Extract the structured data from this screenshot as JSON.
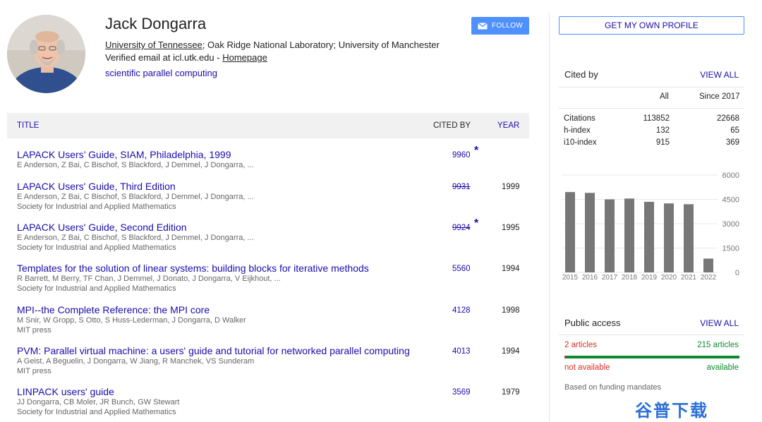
{
  "profile": {
    "name": "Jack Dongarra",
    "affiliation_link": "University of Tennessee",
    "affiliation_rest": "; Oak Ridge National Laboratory; University of Manchester",
    "email_text": "Verified email at icl.utk.edu - ",
    "homepage_label": "Homepage",
    "interest": "scientific parallel computing",
    "follow_label": "FOLLOW",
    "follow_icon": "envelope-icon"
  },
  "table": {
    "col_title": "TITLE",
    "col_cited": "CITED BY",
    "col_year": "YEAR",
    "rows": [
      {
        "title": "LAPACK Users’ Guide, SIAM, Philadelphia, 1999",
        "authors": "E Anderson, Z Bai, C Bischof, S Blackford, J Demmel, J Dongarra, ...",
        "venue": "",
        "cited": "9960",
        "strike": false,
        "star": "*",
        "year": ""
      },
      {
        "title": "LAPACK Users' Guide, Third Edition",
        "authors": "E Anderson, Z Bai, C Bischof, S Blackford, J Demmel, J Dongarra, ...",
        "venue": "Society for Industrial and Applied Mathematics",
        "cited": "9931",
        "strike": true,
        "star": "",
        "year": "1999"
      },
      {
        "title": "LAPACK Users' Guide, Second Edition",
        "authors": "E Anderson, Z Bai, C Bischof, S Blackford, J Demmel, J Dongarra, ...",
        "venue": "Society for Industrial and Applied Mathematics",
        "cited": "9924",
        "strike": true,
        "star": "*",
        "year": "1995"
      },
      {
        "title": "Templates for the solution of linear systems: building blocks for iterative methods",
        "authors": "R Barrett, M Berry, TF Chan, J Demmel, J Donato, J Dongarra, V Eijkhout, ...",
        "venue": "Society for Industrial and Applied Mathematics",
        "cited": "5560",
        "strike": false,
        "star": "",
        "year": "1994"
      },
      {
        "title": "MPI--the Complete Reference: the MPI core",
        "authors": "M Snir, W Gropp, S Otto, S Huss-Lederman, J Dongarra, D Walker",
        "venue": "MIT press",
        "cited": "4128",
        "strike": false,
        "star": "",
        "year": "1998"
      },
      {
        "title": "PVM: Parallel virtual machine: a users' guide and tutorial for networked parallel computing",
        "authors": "A Geist, A Beguelin, J Dongarra, W Jiang, R Manchek, VS Sunderam",
        "venue": "MIT press",
        "cited": "4013",
        "strike": false,
        "star": "",
        "year": "1994"
      },
      {
        "title": "LINPACK users' guide",
        "authors": "JJ Dongarra, CB Moler, JR Bunch, GW Stewart",
        "venue": "Society for Industrial and Applied Mathematics",
        "cited": "3569",
        "strike": false,
        "star": "",
        "year": "1979"
      }
    ]
  },
  "sidebar": {
    "own_profile_label": "GET MY OWN PROFILE",
    "cited_by": {
      "title": "Cited by",
      "view_all": "VIEW ALL",
      "col_all": "All",
      "col_since": "Since 2017",
      "rows": [
        {
          "label": "Citations",
          "all": "113852",
          "since": "22668"
        },
        {
          "label": "h-index",
          "all": "132",
          "since": "65"
        },
        {
          "label": "i10-index",
          "all": "915",
          "since": "369"
        }
      ]
    },
    "public_access": {
      "title": "Public access",
      "view_all": "VIEW ALL",
      "left_count": "2 articles",
      "right_count": "215 articles",
      "left_label": "not available",
      "right_label": "available",
      "note": "Based on funding mandates",
      "colors": {
        "not_available": "#d93025",
        "available": "#0f8a30"
      }
    }
  },
  "chart_data": {
    "type": "bar",
    "categories": [
      "2015",
      "2016",
      "2017",
      "2018",
      "2019",
      "2020",
      "2021",
      "2022"
    ],
    "values": [
      4950,
      4900,
      4500,
      4550,
      4350,
      4250,
      4200,
      850
    ],
    "ylim": [
      0,
      6000
    ],
    "yticks": [
      "6000",
      "4500",
      "3000",
      "1500",
      "0"
    ],
    "ytick_values": [
      6000,
      4500,
      3000,
      1500,
      0
    ],
    "bar_color": "#777777",
    "grid": true
  },
  "watermark": "谷普下载"
}
